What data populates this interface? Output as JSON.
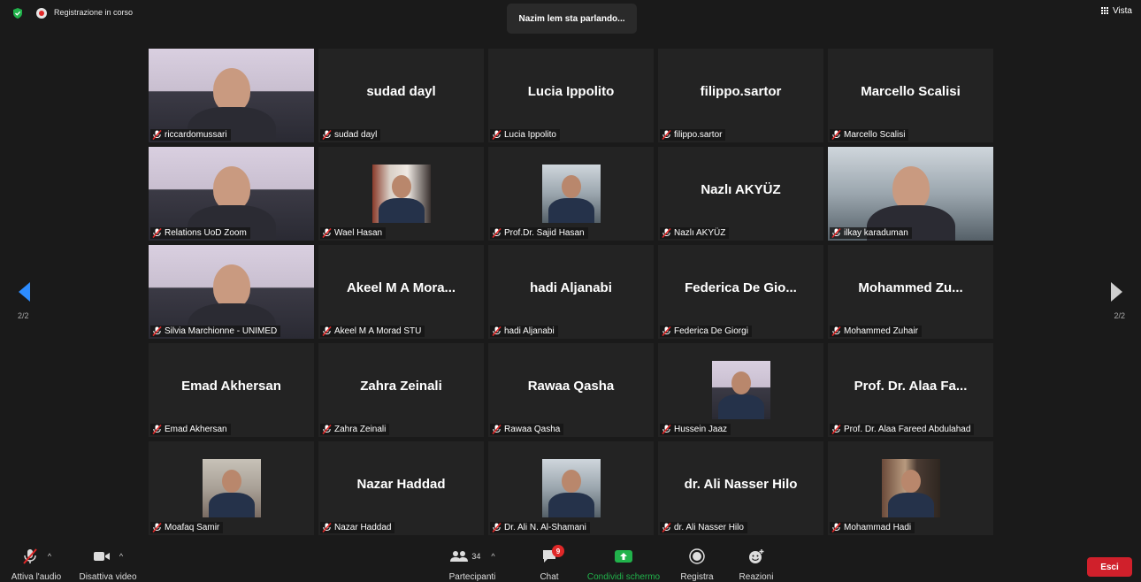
{
  "top": {
    "recording_label": "Registrazione in corso",
    "speaker_banner": "Nazim lem sta parlando...",
    "view_label": "Vista"
  },
  "pagination": {
    "left": "2/2",
    "right": "2/2"
  },
  "participants": [
    {
      "name": "riccardomussari",
      "display": "",
      "kind": "video"
    },
    {
      "name": "sudad dayl",
      "display": "sudad dayl",
      "kind": "name"
    },
    {
      "name": "Lucia Ippolito",
      "display": "Lucia Ippolito",
      "kind": "name"
    },
    {
      "name": "filippo.sartor",
      "display": "filippo.sartor",
      "kind": "name"
    },
    {
      "name": "Marcello Scalisi",
      "display": "Marcello Scalisi",
      "kind": "name"
    },
    {
      "name": "Relations UoD Zoom",
      "display": "",
      "kind": "video"
    },
    {
      "name": "Wael Hasan",
      "display": "",
      "kind": "avatar"
    },
    {
      "name": "Prof.Dr. Sajid Hasan",
      "display": "",
      "kind": "avatar"
    },
    {
      "name": "Nazlı AKYÜZ",
      "display": "Nazlı AKYÜZ",
      "kind": "name"
    },
    {
      "name": "ilkay karaduman",
      "display": "",
      "kind": "video"
    },
    {
      "name": "Silvia Marchionne - UNIMED",
      "display": "",
      "kind": "video"
    },
    {
      "name": "Akeel M A Morad STU",
      "display": "Akeel M A Mora...",
      "kind": "name"
    },
    {
      "name": "hadi Aljanabi",
      "display": "hadi Aljanabi",
      "kind": "name"
    },
    {
      "name": "Federica De Giorgi",
      "display": "Federica De Gio...",
      "kind": "name"
    },
    {
      "name": "Mohammed Zuhair",
      "display": "Mohammed Zu...",
      "kind": "name"
    },
    {
      "name": "Emad Akhersan",
      "display": "Emad Akhersan",
      "kind": "name"
    },
    {
      "name": "Zahra Zeinali",
      "display": "Zahra Zeinali",
      "kind": "name"
    },
    {
      "name": "Rawaa Qasha",
      "display": "Rawaa Qasha",
      "kind": "name"
    },
    {
      "name": "Hussein Jaaz",
      "display": "",
      "kind": "avatar"
    },
    {
      "name": "Prof. Dr. Alaa Fareed Abdulahad",
      "display": "Prof. Dr. Alaa Fa...",
      "kind": "name"
    },
    {
      "name": "Moafaq Samir",
      "display": "",
      "kind": "avatar"
    },
    {
      "name": "Nazar Haddad",
      "display": "Nazar Haddad",
      "kind": "name"
    },
    {
      "name": "Dr. Ali N. Al-Shamani",
      "display": "",
      "kind": "avatar"
    },
    {
      "name": "dr. Ali Nasser Hilo",
      "display": "dr. Ali Nasser Hilo",
      "kind": "name"
    },
    {
      "name": "Mohammad Hadi",
      "display": "",
      "kind": "avatar"
    }
  ],
  "toolbar": {
    "audio": "Attiva l'audio",
    "video": "Disattiva video",
    "participants": "Partecipanti",
    "participants_count": "34",
    "chat": "Chat",
    "chat_badge": "9",
    "share": "Condividi schermo",
    "record": "Registra",
    "reactions": "Reazioni",
    "leave": "Esci"
  },
  "colors": {
    "share_label": "#21b24b",
    "leave_button": "#d0202b",
    "nav_active": "#2d8cff",
    "recording": "#e02828"
  }
}
